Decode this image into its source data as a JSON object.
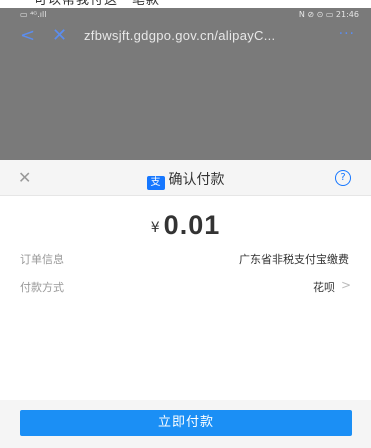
{
  "top_caption": "可以帮我付这一笔款",
  "status_bar": {
    "left": "▭ ⁴ᴳ.ıll",
    "right": "N ⊘ ⊙ ▭ 21:46"
  },
  "browser_nav": {
    "back_icon": "back-arrow-icon",
    "close_icon": "close-icon",
    "url": "zfbwsjft.gdgpo.gov.cn/alipayC...",
    "more": "···"
  },
  "sheet": {
    "close_glyph": "✕",
    "title": "确认付款",
    "logo_text": "支",
    "help_glyph": "?",
    "amount_currency": "¥",
    "amount_value": "0.01",
    "rows": [
      {
        "label": "订单信息",
        "value": "广东省非税支付宝缴费"
      },
      {
        "label": "付款方式",
        "value": "花呗",
        "chevron": ">"
      }
    ],
    "pay_button": "立即付款"
  },
  "colors": {
    "accent": "#1677ff",
    "button": "#1b8ff5",
    "overlay": "#7a7a7a"
  }
}
